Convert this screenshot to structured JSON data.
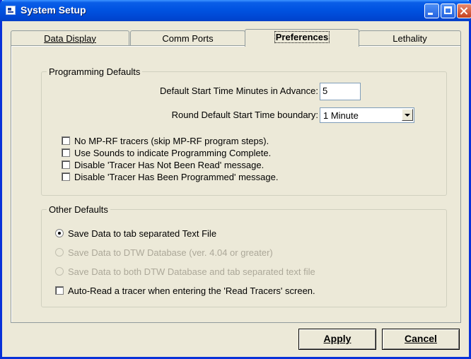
{
  "window": {
    "title": "System Setup"
  },
  "tabs": [
    {
      "label": "Data Display",
      "active": false
    },
    {
      "label": "Comm Ports",
      "active": false
    },
    {
      "label": "Preferences",
      "active": true
    },
    {
      "label": "Lethality",
      "active": false
    }
  ],
  "programming": {
    "legend": "Programming Defaults",
    "start_time_label": "Default Start Time Minutes in Advance:",
    "start_time_value": "5",
    "round_label": "Round Default Start Time boundary:",
    "round_value": "1 Minute",
    "checks": [
      {
        "label": "No MP-RF tracers (skip MP-RF program steps).",
        "checked": false
      },
      {
        "label": "Use Sounds to indicate Programming Complete.",
        "checked": false
      },
      {
        "label": "Disable 'Tracer Has Not Been Read' message.",
        "checked": false
      },
      {
        "label": "Disable 'Tracer Has Been Programmed' message.",
        "checked": false
      }
    ]
  },
  "other": {
    "legend": "Other Defaults",
    "radios": [
      {
        "label": "Save Data to tab separated Text File",
        "selected": true,
        "enabled": true
      },
      {
        "label": "Save Data to DTW Database (ver. 4.04 or greater)",
        "selected": false,
        "enabled": false
      },
      {
        "label": "Save Data to both DTW Database and tab separated text file",
        "selected": false,
        "enabled": false
      }
    ],
    "auto_read_label": "Auto-Read a tracer when entering the 'Read Tracers' screen.",
    "auto_read_checked": false
  },
  "buttons": {
    "apply": "Apply",
    "cancel": "Cancel"
  }
}
